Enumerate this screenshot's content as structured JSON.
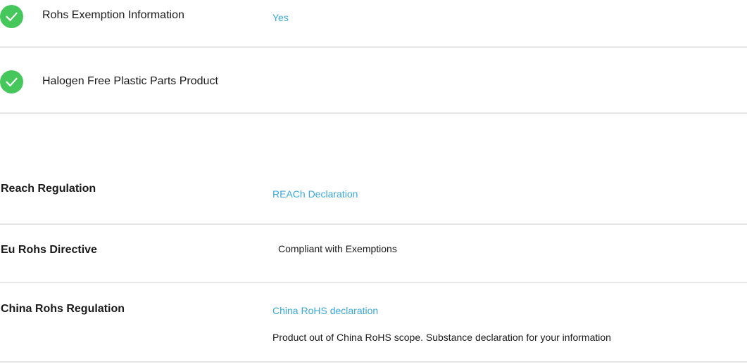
{
  "colors": {
    "check_green": "#45c75b",
    "link_blue": "#3aa8d8",
    "divider": "#e6e6e6"
  },
  "features": [
    {
      "icon": "check-circle-icon",
      "label": "Rohs Exemption Information",
      "value": "Yes"
    },
    {
      "icon": "check-circle-icon",
      "label": "Halogen Free Plastic Parts Product"
    }
  ],
  "regulations": [
    {
      "label": "Reach Regulation",
      "link": "REACh Declaration"
    },
    {
      "label": "Eu Rohs Directive",
      "value": "Compliant with Exemptions"
    },
    {
      "label": "China Rohs Regulation",
      "link": "China RoHS declaration",
      "note": "Product out of China RoHS scope. Substance declaration for your information"
    }
  ]
}
